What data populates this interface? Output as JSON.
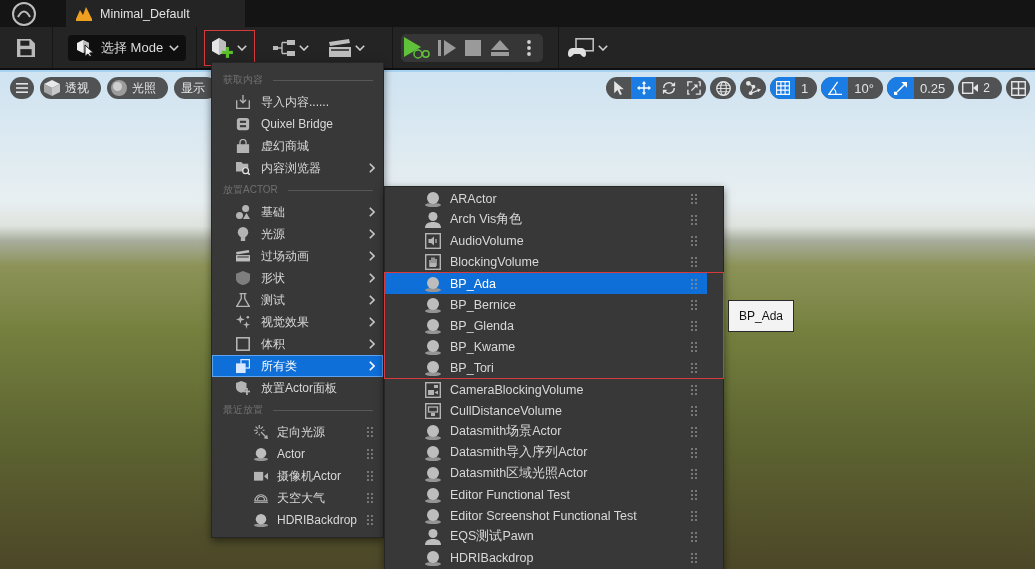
{
  "top_bar": {
    "tabs": [
      {
        "title": "Minimal_Default",
        "selected": true
      }
    ]
  },
  "toolbar": {
    "mode_button": {
      "label": "选择 Mode"
    },
    "add_button": {
      "annotated": true
    }
  },
  "viewport": {
    "view_buttons": [
      {
        "label": "透视"
      },
      {
        "label": "光照"
      },
      {
        "label": "显示"
      }
    ],
    "transform_tools": [
      {
        "selected": false
      },
      {
        "selected": true
      },
      {
        "selected": false
      },
      {
        "selected": false
      }
    ],
    "snap_controls": [
      {
        "kind": "grid",
        "on": true,
        "value": "1"
      },
      {
        "kind": "angle",
        "on": true,
        "value": "10°"
      },
      {
        "kind": "scale",
        "on": true,
        "value": "0.25"
      }
    ],
    "camera_speed": {
      "value": "2"
    }
  },
  "add_menu": {
    "sections": [
      {
        "kind": "commands",
        "title": "获取内容",
        "items": [
          {
            "label": "导入内容......",
            "submenu": false,
            "selected": false
          },
          {
            "label": "Quixel Bridge",
            "submenu": false,
            "selected": false
          },
          {
            "label": "虚幻商城",
            "submenu": false,
            "selected": false
          },
          {
            "label": "内容浏览器",
            "submenu": true,
            "selected": false
          }
        ]
      },
      {
        "kind": "commands",
        "title": "放置ACTOR",
        "items": [
          {
            "label": "基础",
            "submenu": true,
            "selected": false
          },
          {
            "label": "光源",
            "submenu": true,
            "selected": false
          },
          {
            "label": "过场动画",
            "submenu": true,
            "selected": false
          },
          {
            "label": "形状",
            "submenu": true,
            "selected": false
          },
          {
            "label": "测试",
            "submenu": true,
            "selected": false
          },
          {
            "label": "视觉效果",
            "submenu": true,
            "selected": false
          },
          {
            "label": "体积",
            "submenu": true,
            "selected": false
          },
          {
            "label": "所有类",
            "submenu": true,
            "selected": true
          },
          {
            "label": "放置Actor面板",
            "submenu": false,
            "selected": false
          }
        ]
      },
      {
        "kind": "recent",
        "title": "最近放置",
        "items": [
          {
            "label": "定向光源",
            "selected": false
          },
          {
            "label": "Actor",
            "selected": false
          },
          {
            "label": "摄像机Actor",
            "selected": false
          },
          {
            "label": "天空大气",
            "selected": false
          },
          {
            "label": "HDRIBackdrop",
            "selected": false
          }
        ]
      }
    ]
  },
  "class_menu": {
    "items": [
      {
        "label": "ARActor",
        "selected": false,
        "annotated": false
      },
      {
        "label": "Arch Vis角色",
        "selected": false,
        "annotated": false
      },
      {
        "label": "AudioVolume",
        "selected": false,
        "annotated": false
      },
      {
        "label": "BlockingVolume",
        "selected": false,
        "annotated": false
      },
      {
        "label": "BP_Ada",
        "selected": true,
        "annotated": true
      },
      {
        "label": "BP_Bernice",
        "selected": false,
        "annotated": true
      },
      {
        "label": "BP_Glenda",
        "selected": false,
        "annotated": true
      },
      {
        "label": "BP_Kwame",
        "selected": false,
        "annotated": true
      },
      {
        "label": "BP_Tori",
        "selected": false,
        "annotated": true
      },
      {
        "label": "CameraBlockingVolume",
        "selected": false,
        "annotated": false
      },
      {
        "label": "CullDistanceVolume",
        "selected": false,
        "annotated": false
      },
      {
        "label": "Datasmith场景Actor",
        "selected": false,
        "annotated": false
      },
      {
        "label": "Datasmith导入序列Actor",
        "selected": false,
        "annotated": false
      },
      {
        "label": "Datasmith区域光照Actor",
        "selected": false,
        "annotated": false
      },
      {
        "label": "Editor Functional Test",
        "selected": false,
        "annotated": false
      },
      {
        "label": "Editor Screenshot Functional Test",
        "selected": false,
        "annotated": false
      },
      {
        "label": "EQS测试Pawn",
        "selected": false,
        "annotated": false
      },
      {
        "label": "HDRIBackdrop",
        "selected": false,
        "annotated": false
      }
    ]
  },
  "tooltip": {
    "text": "BP_Ada"
  }
}
